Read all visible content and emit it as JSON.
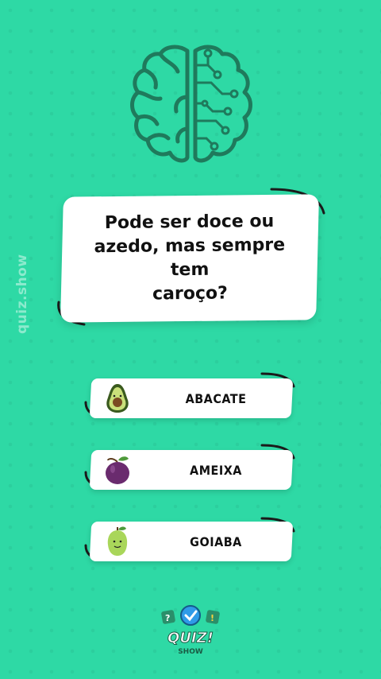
{
  "watermark": "quiz.show",
  "question": {
    "lines": [
      "Pode ser doce ou",
      "azedo, mas sempre tem",
      "caroço?"
    ]
  },
  "answers": [
    {
      "label": "ABACATE",
      "icon": "avocado-icon"
    },
    {
      "label": "AMEIXA",
      "icon": "plum-icon"
    },
    {
      "label": "GOIABA",
      "icon": "guava-icon"
    }
  ],
  "logo": {
    "text": "QUIZ!",
    "subtext": "SHOW"
  },
  "colors": {
    "background": "#2ed9a5",
    "brain_stroke": "#1f7a5c",
    "card": "#ffffff"
  }
}
